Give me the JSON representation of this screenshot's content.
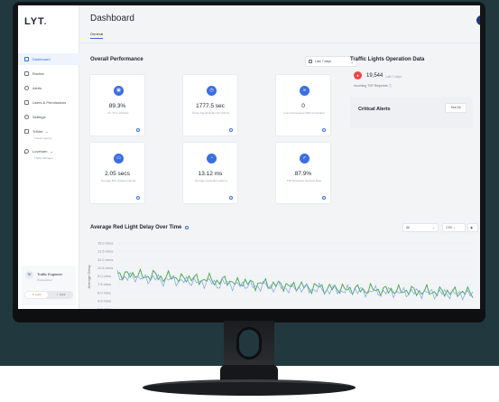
{
  "app": {
    "logo": "LYT",
    "logo_dot": ".",
    "page_title": "Dashboard",
    "tab_general": "General",
    "help_icon_glyph": "?"
  },
  "sidebar": {
    "items": [
      {
        "label": "Dashboard",
        "icon": "grid-icon"
      },
      {
        "label": "Routes",
        "icon": "route-icon"
      },
      {
        "label": "Alerts",
        "icon": "alert-icon"
      },
      {
        "label": "Users & Permissions",
        "icon": "users-icon"
      },
      {
        "label": "Settings",
        "icon": "gear-icon"
      },
      {
        "label": "TriMet",
        "sub": "Transit Agency",
        "icon": "building-icon"
      },
      {
        "label": "Loveham",
        "sub": "Traffic Manager",
        "icon": "location-icon"
      }
    ],
    "user": {
      "initials": "TE",
      "name": "Traffic Engineer",
      "role": "Professional"
    },
    "theme": {
      "light": "Light",
      "dark": "Dark"
    }
  },
  "performance": {
    "title": "Overall Performance",
    "date_range": "Last 7 days",
    "cards": [
      {
        "value": "89.3%",
        "label": "On Time Vehicles",
        "icon": "bus-icon"
      },
      {
        "value": "1777.5 sec",
        "label": "Delay Signal Delay Per Vehicle",
        "icon": "clock-icon"
      },
      {
        "value": "0",
        "label": "Lost Connections With Controllers",
        "icon": "link-icon"
      },
      {
        "value": "2.05 secs",
        "label": "Average Bus Update Interval",
        "icon": "monitor-icon"
      },
      {
        "value": "13.12 ms",
        "label": "Average Controller Latency",
        "icon": "speed-icon"
      },
      {
        "value": "87.9%",
        "label": "TSP Requests Success Rate",
        "icon": "check-icon"
      }
    ]
  },
  "traffic_lights": {
    "title": "Traffic Lights Operation Data",
    "value": "19,544",
    "period": "Last 7 days",
    "sub_label": "Incoming TSP Requests"
  },
  "alerts": {
    "title": "Critical Alerts",
    "see_all": "See All"
  },
  "chart_controls": {
    "filter": "All",
    "csv": "CSV",
    "download_glyph": "↓",
    "eye_glyph": "◉"
  },
  "chart_data": {
    "type": "line",
    "title": "Average Red Light Delay Over Time",
    "ylabel": "Average Delay",
    "y_ticks": [
      "15.0 mins",
      "13.5 mins",
      "12.0 mins",
      "10.5 mins",
      "9.0 mins",
      "7.5 mins",
      "6.0 mins",
      "4.5 mins",
      "3.0 mins"
    ],
    "ylim": [
      3.0,
      15.0
    ],
    "series": [
      {
        "color": "#3fa64a",
        "values": [
          9.6,
          9.1,
          9.4,
          8.8,
          9.2,
          8.6,
          9.0,
          8.4,
          8.8,
          8.2,
          8.5,
          7.9,
          8.3,
          7.6,
          8.0,
          7.4,
          7.7,
          7.3,
          7.5,
          7.0,
          7.3,
          6.8,
          7.1,
          6.6,
          6.9,
          6.5,
          6.7,
          6.4,
          6.6,
          6.3,
          6.5,
          6.2,
          6.4,
          6.1,
          6.3,
          6.0,
          6.2,
          6.0,
          6.1,
          5.9
        ]
      },
      {
        "color": "#7ea3e8",
        "values": [
          9.0,
          8.6,
          8.9,
          8.3,
          8.7,
          8.1,
          8.5,
          7.9,
          8.2,
          7.7,
          8.0,
          7.4,
          7.8,
          7.2,
          7.5,
          7.0,
          7.3,
          6.9,
          7.1,
          6.6,
          6.9,
          6.5,
          6.7,
          6.3,
          6.6,
          6.2,
          6.4,
          6.1,
          6.3,
          6.0,
          6.2,
          5.9,
          6.1,
          5.9,
          6.0,
          5.8,
          5.9,
          5.7,
          5.8,
          5.6
        ]
      }
    ]
  }
}
